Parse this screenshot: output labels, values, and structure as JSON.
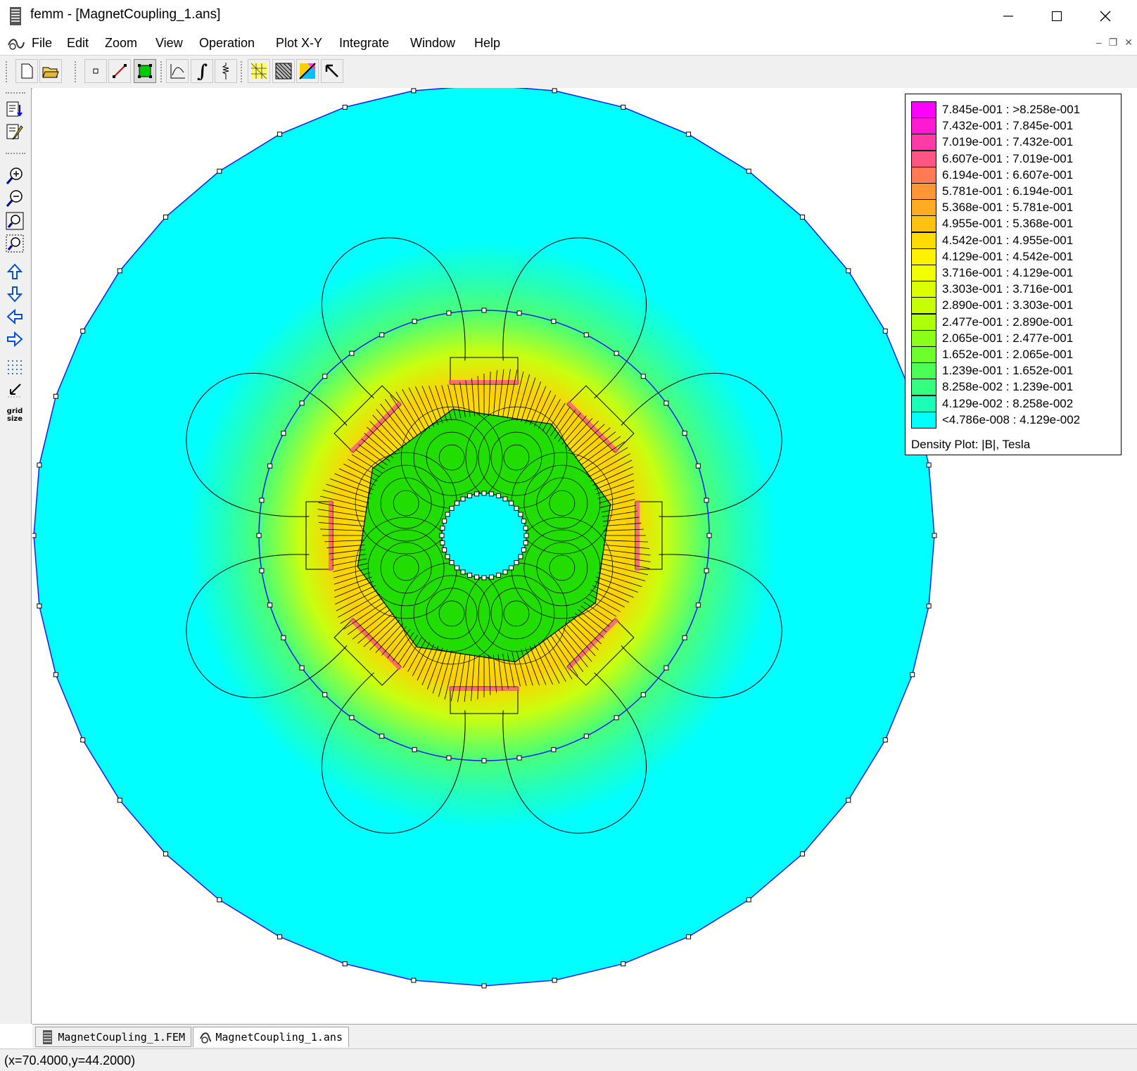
{
  "window": {
    "title": "femm - [MagnetCoupling_1.ans]"
  },
  "menu": [
    "File",
    "Edit",
    "Zoom",
    "View",
    "Operation",
    "Plot X-Y",
    "Integrate",
    "Window",
    "Help"
  ],
  "toolbar_icons": [
    "new-file-icon",
    "open-folder-icon",
    "point-mode-icon",
    "contour-mode-icon",
    "area-mode-icon",
    "plot-xy-icon",
    "integrate-icon",
    "circuit-props-icon",
    "mesh-toggle-icon",
    "density-plot-icon",
    "vector-plot-icon",
    "select-arrow-icon"
  ],
  "left_toolbar_icons": [
    "show-points-icon",
    "edit-icon",
    "zoom-in-icon",
    "zoom-out-icon",
    "zoom-natural-icon",
    "zoom-window-icon",
    "pan-up-icon",
    "pan-down-icon",
    "pan-left-icon",
    "pan-right-icon",
    "show-grid-icon",
    "snap-grid-icon",
    "grid-size-icon"
  ],
  "grid_size_label": [
    "grid",
    "size"
  ],
  "legend": {
    "rows": [
      {
        "label": "7.845e-001 : >8.258e-001",
        "color": "#ff00ff"
      },
      {
        "label": "7.432e-001 : 7.845e-001",
        "color": "#ff19d0"
      },
      {
        "label": "7.019e-001 : 7.432e-001",
        "color": "#ff3aa8"
      },
      {
        "label": "6.607e-001 : 7.019e-001",
        "color": "#ff5584"
      },
      {
        "label": "6.194e-001 : 6.607e-001",
        "color": "#ff7a55"
      },
      {
        "label": "5.781e-001 : 6.194e-001",
        "color": "#ff9636"
      },
      {
        "label": "5.368e-001 : 5.781e-001",
        "color": "#ffac20"
      },
      {
        "label": "4.955e-001 : 5.368e-001",
        "color": "#ffc30f"
      },
      {
        "label": "4.542e-001 : 4.955e-001",
        "color": "#ffdb05"
      },
      {
        "label": "4.129e-001 : 4.542e-001",
        "color": "#fff200"
      },
      {
        "label": "3.716e-001 : 4.129e-001",
        "color": "#f2ff00"
      },
      {
        "label": "3.303e-001 : 3.716e-001",
        "color": "#dcff00"
      },
      {
        "label": "2.890e-001 : 3.303e-001",
        "color": "#c5ff00"
      },
      {
        "label": "2.477e-001 : 2.890e-001",
        "color": "#adff0a"
      },
      {
        "label": "2.065e-001 : 2.477e-001",
        "color": "#8cff18"
      },
      {
        "label": "1.652e-001 : 2.065e-001",
        "color": "#6cff2c"
      },
      {
        "label": "1.239e-001 : 1.652e-001",
        "color": "#4cff55"
      },
      {
        "label": "8.258e-002 : 1.239e-001",
        "color": "#33ff80"
      },
      {
        "label": "4.129e-002 : 8.258e-002",
        "color": "#1affb5"
      },
      {
        "label": "<4.786e-008 : 4.129e-002",
        "color": "#00ffff"
      }
    ],
    "caption": "Density Plot: |B|, Tesla"
  },
  "tabs": [
    {
      "label": "MagnetCoupling_1.FEM",
      "icon": "femm-doc-icon"
    },
    {
      "label": "MagnetCoupling_1.ans",
      "icon": "femm-plot-icon"
    }
  ],
  "status": "(x=70.4000,y=44.2000)",
  "colors": {
    "boundary": "#1a1aff",
    "background_field": "#00ffff",
    "rotor_core": "#22dd00",
    "flux_line": "#000000"
  }
}
